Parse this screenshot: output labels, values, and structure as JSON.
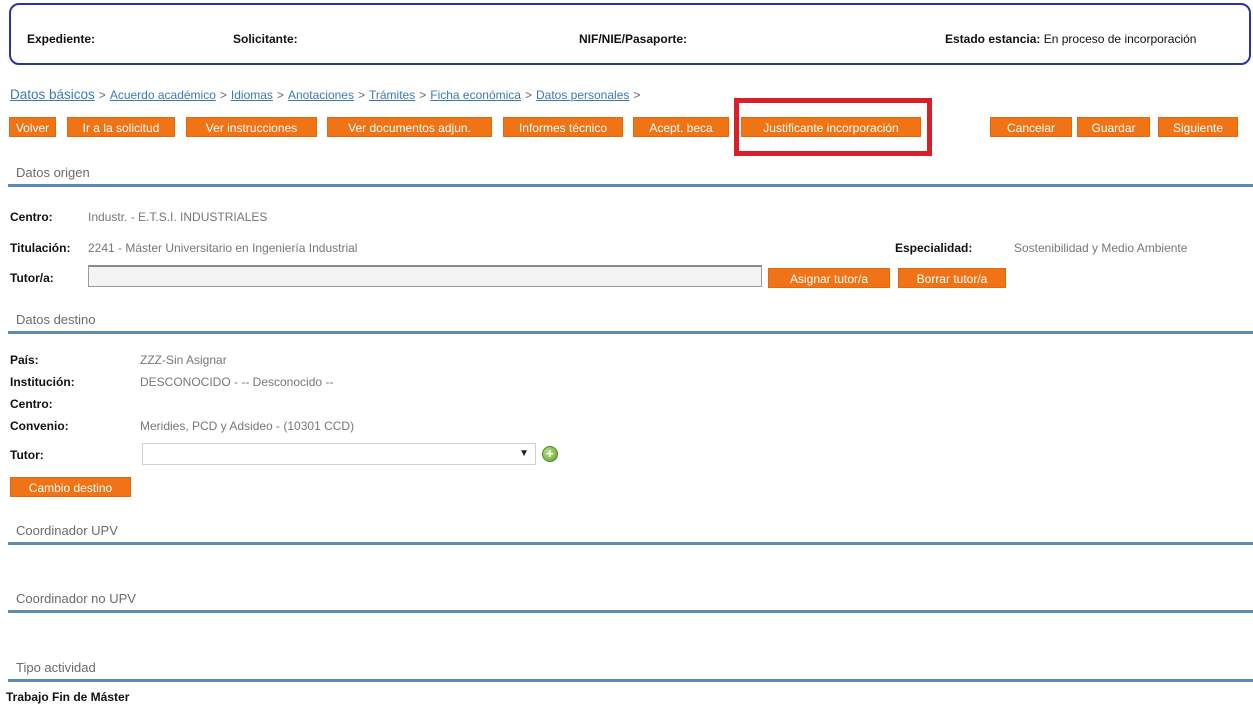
{
  "header": {
    "expediente_label": "Expediente:",
    "solicitante_label": "Solicitante:",
    "nif_label": "NIF/NIE/Pasaporte:",
    "estado_label": "Estado estancia:",
    "estado_value": "En proceso de incorporación"
  },
  "breadcrumb": {
    "items": [
      "Datos básicos",
      "Acuerdo académico",
      "Idiomas",
      "Anotaciones",
      "Trámites",
      "Ficha económica",
      "Datos personales"
    ],
    "separator": ">"
  },
  "toolbar": {
    "volver": "Volver",
    "ir_solicitud": "Ir a la solicitud",
    "ver_instrucciones": "Ver instrucciones",
    "ver_documentos": "Ver documentos adjun.",
    "informes": "Informes técnico",
    "acept_beca": "Acept. beca",
    "justificante": "Justificante incorporación",
    "cancelar": "Cancelar",
    "guardar": "Guardar",
    "siguiente": "Siguiente"
  },
  "datos_origen": {
    "title": "Datos origen",
    "centro_label": "Centro:",
    "centro_value": "Industr. - E.T.S.I. INDUSTRIALES",
    "titulacion_label": "Titulación:",
    "titulacion_value": "2241 - Máster Universitario en Ingeniería Industrial",
    "especialidad_label": "Especialidad:",
    "especialidad_value": "Sostenibilidad y Medio Ambiente",
    "tutor_label": "Tutor/a:",
    "tutor_value": "",
    "asignar_tutor": "Asignar tutor/a",
    "borrar_tutor": "Borrar tutor/a"
  },
  "datos_destino": {
    "title": "Datos destino",
    "pais_label": "País:",
    "pais_value": "ZZZ-Sin Asignar",
    "institucion_label": "Institución:",
    "institucion_value": "DESCONOCIDO - -- Desconocido --",
    "centro_label": "Centro:",
    "convenio_label": "Convenio:",
    "convenio_value": "Meridies, PCD y Adsideo - (10301 CCD)",
    "tutor_label": "Tutor:",
    "tutor_selected": "",
    "cambio_destino": "Cambio destino"
  },
  "coordinador_upv": {
    "title": "Coordinador UPV"
  },
  "coordinador_no_upv": {
    "title": "Coordinador no UPV"
  },
  "tipo_actividad": {
    "title": "Tipo actividad",
    "value": "Trabajo Fin de Máster"
  },
  "colors": {
    "accent": "#f07416",
    "section_line": "#5d8cb3",
    "header_border": "#2a34a8",
    "highlight": "#d8202a",
    "link": "#3c7ab4"
  },
  "icons": {
    "add": "add-circle-icon",
    "dropdown": "chevron-down-icon"
  }
}
